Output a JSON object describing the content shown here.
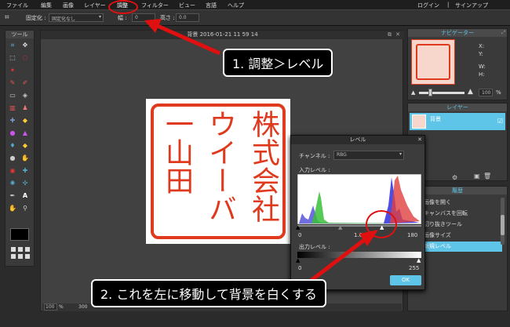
{
  "menu": [
    "ファイル",
    "編集",
    "画像",
    "レイヤー",
    "調整",
    "フィルター",
    "ビュー",
    "言語",
    "ヘルプ"
  ],
  "account": {
    "login": "ログイン",
    "separator": "|",
    "signup": "サインアップ"
  },
  "options": {
    "lock_label": "固定化 :",
    "lock_value": "固定化なし",
    "width_label": "幅 :",
    "width_value": "0",
    "height_label": "高さ :",
    "height_value": "0.0"
  },
  "tools": {
    "title": "ツール"
  },
  "document": {
    "title": "背景 2016-01-21 11 59 14",
    "zoom": "100",
    "zoom_unit": "%",
    "size": "300"
  },
  "stamp": {
    "columns": [
      "株式会社",
      "ウイーバ",
      "一山田"
    ]
  },
  "navigator": {
    "title": "ナビゲーター",
    "x": "X:",
    "y": "Y:",
    "w": "W:",
    "h": "H:",
    "zoom": "100",
    "unit": "%"
  },
  "layers": {
    "title": "レイヤー",
    "item": "背景"
  },
  "history": {
    "title": "履歴",
    "items": [
      "画像を開く",
      "キャンバスを回転",
      "切り抜きツール",
      "画像サイズ",
      "新規レベル"
    ],
    "selected_index": 4
  },
  "levels_dialog": {
    "title": "レベル",
    "channel_label": "チャンネル :",
    "channel_value": "RBG",
    "input_label": "入力レベル :",
    "input_min": "0",
    "input_mid": "1.00",
    "input_max": "180",
    "output_label": "出力レベル :",
    "output_min": "0",
    "output_max": "255",
    "ok": "OK"
  },
  "callouts": {
    "step1": "1. 調整＞レベル",
    "step2": "2. これを左に移動して背景を白くする"
  },
  "colors": {
    "accent": "#5ec4e8",
    "stamp_red": "#e03a1e",
    "annotation_red": "#e01010"
  }
}
